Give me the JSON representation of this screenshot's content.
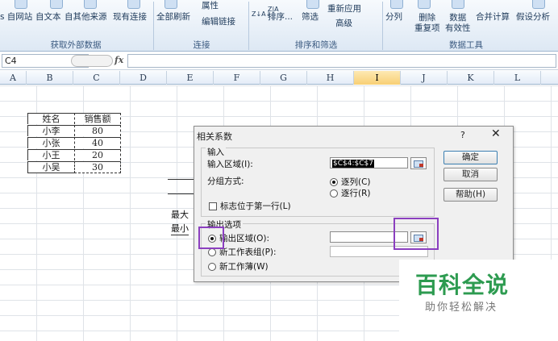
{
  "ribbon": {
    "buttons": [
      "s 自网站",
      "自文本",
      "自其他来源",
      "现有连接",
      "全部刷新",
      "属性",
      "编辑链接",
      "排序...",
      "筛选",
      "重新应用",
      "高级",
      "分列",
      "删除\n重复项",
      "数据\n有效性",
      "合并计算",
      "假设分析"
    ],
    "sort_icons": [
      "Z↓A↓",
      "Z|A"
    ],
    "groups": [
      "获取外部数据",
      "连接",
      "排序和筛选",
      "数据工具"
    ]
  },
  "formula_bar": {
    "name_box": "C4",
    "fx": "fx"
  },
  "columns": [
    "A",
    "B",
    "C",
    "D",
    "E",
    "F",
    "G",
    "H",
    "I",
    "J",
    "K",
    "L"
  ],
  "table": {
    "headers": [
      "姓名",
      "销售额"
    ],
    "rows": [
      [
        "小李",
        "80"
      ],
      [
        "小张",
        "40"
      ],
      [
        "小王",
        "20"
      ],
      [
        "小吴",
        "30"
      ]
    ]
  },
  "side_labels": [
    "最大",
    "最小"
  ],
  "dialog": {
    "title": "相关系数",
    "help_q": "?",
    "close": "✕",
    "input_section": "输入",
    "input_range_label": "输入区域(I):",
    "input_range_value": "$C$4:$C$7",
    "group_by_label": "分组方式:",
    "by_column": "逐列(C)",
    "by_row": "逐行(R)",
    "labels_first_row": "标志位于第一行(L)",
    "output_section": "输出选项",
    "output_range": "输出区域(O):",
    "new_sheet": "新工作表组(P):",
    "new_workbook": "新工作薄(W)",
    "ok": "确定",
    "cancel": "取消",
    "help": "帮助(H)"
  },
  "watermark": {
    "title": "百科全说",
    "subtitle": "助你轻松解决"
  },
  "colors": {
    "highlight": "#8b3fbf",
    "watermark_green": "#2d9b50",
    "selected_col": "#f8cf74"
  }
}
